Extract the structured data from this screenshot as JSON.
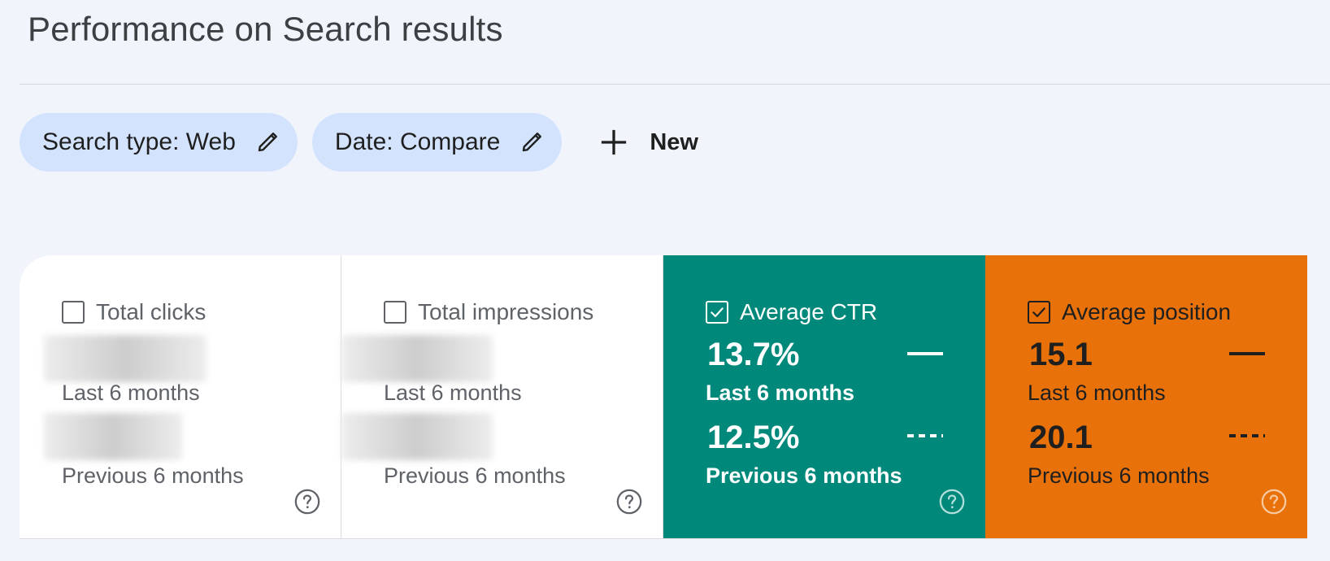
{
  "page": {
    "title": "Performance on Search results"
  },
  "filters": {
    "chips": [
      {
        "label": "Search type: Web",
        "icon": "pencil-icon"
      },
      {
        "label": "Date: Compare",
        "icon": "pencil-icon"
      }
    ],
    "new_label": "New",
    "new_icon": "plus-icon"
  },
  "metrics": [
    {
      "label": "Total clicks",
      "checked": false,
      "current_value": "",
      "current_period": "Last 6 months",
      "previous_value": "",
      "previous_period": "Previous 6 months",
      "help_icon": "help-icon"
    },
    {
      "label": "Total impressions",
      "checked": false,
      "current_value": "",
      "current_period": "Last 6 months",
      "previous_value": "",
      "previous_period": "Previous 6 months",
      "help_icon": "help-icon"
    },
    {
      "label": "Average CTR",
      "checked": true,
      "current_value": "13.7%",
      "current_period": "Last 6 months",
      "previous_value": "12.5%",
      "previous_period": "Previous 6 months",
      "color": "#00897b",
      "help_icon": "help-icon"
    },
    {
      "label": "Average position",
      "checked": true,
      "current_value": "15.1",
      "current_period": "Last 6 months",
      "previous_value": "20.1",
      "previous_period": "Previous 6 months",
      "color": "#e8710a",
      "help_icon": "help-icon"
    }
  ],
  "colors": {
    "background": "#f1f5fb",
    "chip": "#d3e3fd",
    "ctr": "#00897b",
    "position": "#e8710a"
  }
}
